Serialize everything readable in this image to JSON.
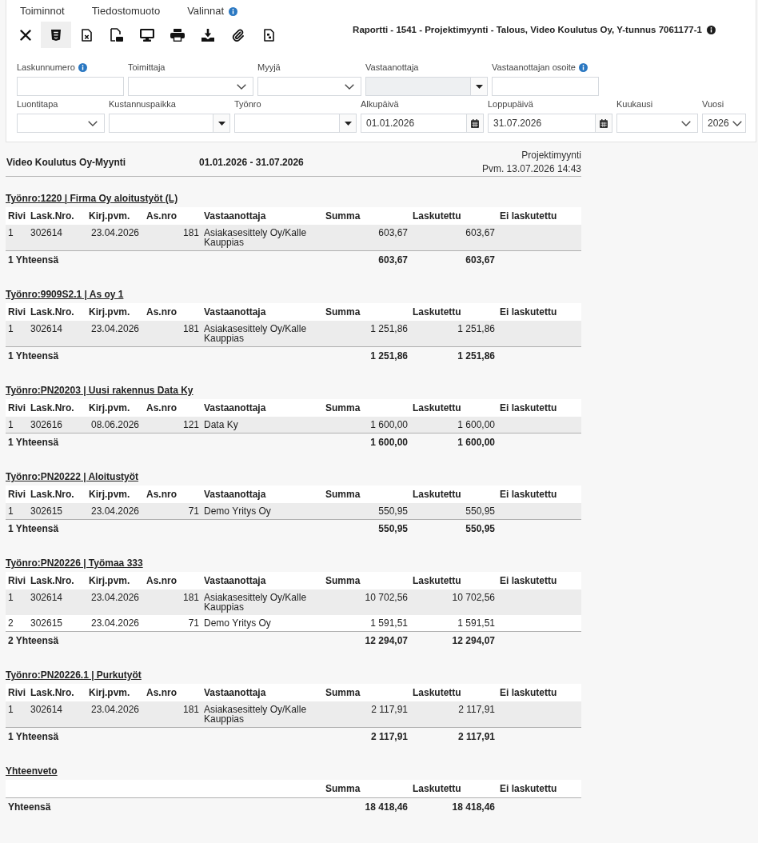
{
  "menu": [
    {
      "label": "Toiminnot",
      "info": false
    },
    {
      "label": "Tiedostomuoto",
      "info": false
    },
    {
      "label": "Valinnat",
      "info": true
    }
  ],
  "toolbar": [
    {
      "kind": "close",
      "selected": false
    },
    {
      "kind": "html",
      "selected": true
    },
    {
      "kind": "excel",
      "selected": false
    },
    {
      "kind": "pdf",
      "selected": false
    },
    {
      "kind": "screen",
      "selected": false
    },
    {
      "kind": "print",
      "selected": false
    },
    {
      "kind": "download",
      "selected": false
    },
    {
      "kind": "attach",
      "selected": false
    },
    {
      "kind": "file",
      "selected": false
    }
  ],
  "report_title": {
    "text": "Raportti - 1541 - Projektimyynti - Talous, Video Koulutus Oy, Y-tunnus 7061177-1",
    "info": true
  },
  "filter_rows": [
    {
      "fields": [
        {
          "label": "Laskunnumero",
          "kind": "text",
          "info": true,
          "disabled": false
        },
        {
          "label": "Toimittaja",
          "kind": "select",
          "info": false,
          "disabled": false
        },
        {
          "label": "Myyjä",
          "kind": "select",
          "info": false,
          "disabled": false
        },
        {
          "label": "Vastaanottaja",
          "kind": "combo",
          "info": false,
          "disabled": true
        },
        {
          "label": "Vastaanottajan osoite",
          "kind": "text",
          "info": true,
          "disabled": false
        }
      ]
    },
    {
      "fields": [
        {
          "label": "Luontitapa",
          "kind": "select",
          "info": false,
          "disabled": false
        },
        {
          "label": "Kustannuspaikka",
          "kind": "combo",
          "info": false,
          "disabled": false
        },
        {
          "label": "Työnro",
          "kind": "combo",
          "info": false,
          "disabled": false
        },
        {
          "label": "Alkupäivä",
          "kind": "date",
          "value": "01.01.2026",
          "info": false,
          "disabled": false
        },
        {
          "label": "Loppupäivä",
          "kind": "date",
          "value": "31.07.2026",
          "info": false,
          "disabled": false
        },
        {
          "label": "Kuukausi",
          "kind": "select",
          "info": false,
          "disabled": false
        },
        {
          "label": "Vuosi",
          "kind": "select",
          "value": "2026",
          "info": false,
          "disabled": false
        }
      ]
    }
  ],
  "report": {
    "company": "Video Koulutus Oy-Myynti",
    "period": "01.01.2026 - 31.07.2026",
    "name": "Projektimyynti",
    "printed": "Pvm. 13.07.2026 14:43"
  },
  "groups": [
    {
      "title": "Työnro:1220 | Firma Oy aloitustyöt (L)",
      "columns": [
        "Rivi",
        "Lask.Nro.",
        "Kirj.pvm.",
        "As.nro",
        "Vastaanottaja",
        "Summa",
        "Laskutettu",
        "Ei laskutettu"
      ],
      "rows": [
        {
          "cells": [
            "1",
            "302614",
            "23.04.2026",
            "181",
            "Asiakasesittely Oy/Kalle Kauppias",
            "603,67",
            "603,67"
          ]
        }
      ],
      "total": {
        "label": "1 Yhteensä",
        "values": [
          "603,67",
          "603,67"
        ]
      }
    },
    {
      "title": "Työnro:9909S2.1 | As oy 1",
      "columns": [
        "Rivi",
        "Lask.Nro.",
        "Kirj.pvm.",
        "As.nro",
        "Vastaanottaja",
        "Summa",
        "Laskutettu",
        "Ei laskutettu"
      ],
      "rows": [
        {
          "cells": [
            "1",
            "302614",
            "23.04.2026",
            "181",
            "Asiakasesittely Oy/Kalle Kauppias",
            "1 251,86",
            "1 251,86"
          ]
        }
      ],
      "total": {
        "label": "1 Yhteensä",
        "values": [
          "1 251,86",
          "1 251,86"
        ]
      }
    },
    {
      "title": "Työnro:PN20203 | Uusi rakennus Data Ky",
      "columns": [
        "Rivi",
        "Lask.Nro.",
        "Kirj.pvm.",
        "As.nro",
        "Vastaanottaja",
        "Summa",
        "Laskutettu",
        "Ei laskutettu"
      ],
      "rows": [
        {
          "cells": [
            "1",
            "302616",
            "08.06.2026",
            "121",
            "Data Ky",
            "1 600,00",
            "1 600,00"
          ]
        }
      ],
      "total": {
        "label": "1 Yhteensä",
        "values": [
          "1 600,00",
          "1 600,00"
        ]
      }
    },
    {
      "title": "Työnro:PN20222 | Aloitustyöt",
      "columns": [
        "Rivi",
        "Lask.Nro.",
        "Kirj.pvm.",
        "As.nro",
        "Vastaanottaja",
        "Summa",
        "Laskutettu",
        "Ei laskutettu"
      ],
      "rows": [
        {
          "cells": [
            "1",
            "302615",
            "23.04.2026",
            "71",
            "Demo Yritys Oy",
            "550,95",
            "550,95"
          ]
        }
      ],
      "total": {
        "label": "1 Yhteensä",
        "values": [
          "550,95",
          "550,95"
        ]
      }
    },
    {
      "title": "Työnro:PN20226 | Työmaa 333",
      "columns": [
        "Rivi",
        "Lask.Nro.",
        "Kirj.pvm.",
        "As.nro",
        "Vastaanottaja",
        "Summa",
        "Laskutettu",
        "Ei laskutettu"
      ],
      "rows": [
        {
          "cells": [
            "1",
            "302614",
            "23.04.2026",
            "181",
            "Asiakasesittely Oy/Kalle Kauppias",
            "10 702,56",
            "10 702,56"
          ]
        },
        {
          "cells": [
            "2",
            "302615",
            "23.04.2026",
            "71",
            "Demo Yritys Oy",
            "1 591,51",
            "1 591,51"
          ]
        }
      ],
      "total": {
        "label": "2 Yhteensä",
        "values": [
          "12 294,07",
          "12 294,07"
        ]
      }
    },
    {
      "title": "Työnro:PN20226.1 | Purkutyöt",
      "columns": [
        "Rivi",
        "Lask.Nro.",
        "Kirj.pvm.",
        "As.nro",
        "Vastaanottaja",
        "Summa",
        "Laskutettu",
        "Ei laskutettu"
      ],
      "rows": [
        {
          "cells": [
            "1",
            "302614",
            "23.04.2026",
            "181",
            "Asiakasesittely Oy/Kalle Kauppias",
            "2 117,91",
            "2 117,91"
          ]
        }
      ],
      "total": {
        "label": "1 Yhteensä",
        "values": [
          "2 117,91",
          "2 117,91"
        ]
      }
    }
  ],
  "summary": {
    "title": "Yhteenveto",
    "columns": [
      "Summa",
      "Laskutettu",
      "Ei laskutettu"
    ],
    "total": {
      "label": "Yhteensä",
      "values": [
        "18 418,46",
        "18 418,46"
      ]
    }
  }
}
